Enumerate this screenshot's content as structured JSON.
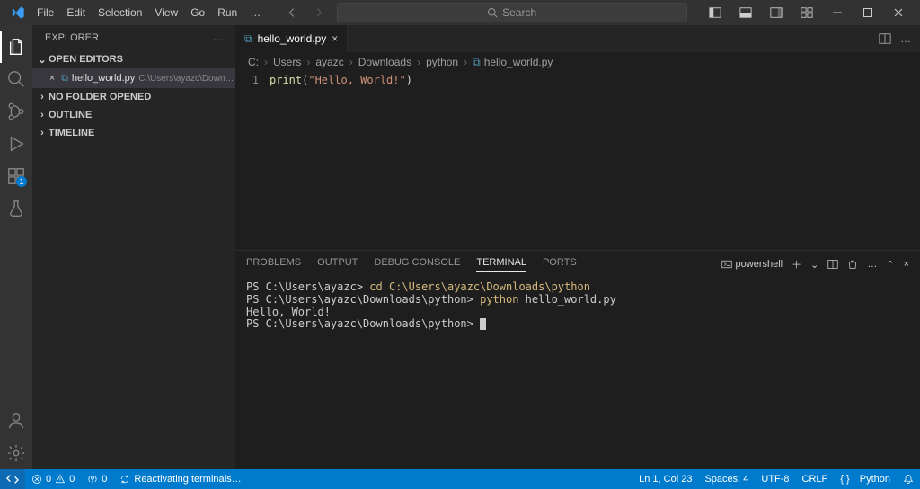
{
  "menu": [
    "File",
    "Edit",
    "Selection",
    "View",
    "Go",
    "Run",
    "…"
  ],
  "search_placeholder": "Search",
  "activity": {
    "extensions_badge": "1"
  },
  "explorer": {
    "title": "EXPLORER",
    "open_editors_label": "OPEN EDITORS",
    "open_file": {
      "name": "hello_world.py",
      "path": "C:\\Users\\ayazc\\Download…"
    },
    "no_folder_label": "NO FOLDER OPENED",
    "outline_label": "OUTLINE",
    "timeline_label": "TIMELINE"
  },
  "tab": {
    "name": "hello_world.py"
  },
  "breadcrumb": [
    "C:",
    "Users",
    "ayazc",
    "Downloads",
    "python",
    "hello_world.py"
  ],
  "editor": {
    "line_number": "1",
    "code": {
      "fn": "print",
      "open": "(",
      "str": "\"Hello, World!\"",
      "close": ")"
    }
  },
  "panel": {
    "tabs": {
      "problems": "PROBLEMS",
      "output": "OUTPUT",
      "debug": "DEBUG CONSOLE",
      "terminal": "TERMINAL",
      "ports": "PORTS"
    },
    "shell_name": "powershell",
    "terminal_lines": {
      "l1_prompt": "PS C:\\Users\\ayazc> ",
      "l1_cmd": "cd C:\\Users\\ayazc\\Downloads\\python",
      "l2_prompt": "PS C:\\Users\\ayazc\\Downloads\\python> ",
      "l2_cmd_a": "python ",
      "l2_cmd_b": "hello_world.py",
      "l3": "Hello, World!",
      "l4_prompt": "PS C:\\Users\\ayazc\\Downloads\\python> "
    }
  },
  "status": {
    "errors": "0",
    "warnings": "0",
    "ports": "0",
    "reactivating": "Reactivating terminals…",
    "lncol": "Ln 1, Col 23",
    "spaces": "Spaces: 4",
    "encoding": "UTF-8",
    "eol": "CRLF",
    "lang_braces": "{ }",
    "lang": "Python"
  }
}
